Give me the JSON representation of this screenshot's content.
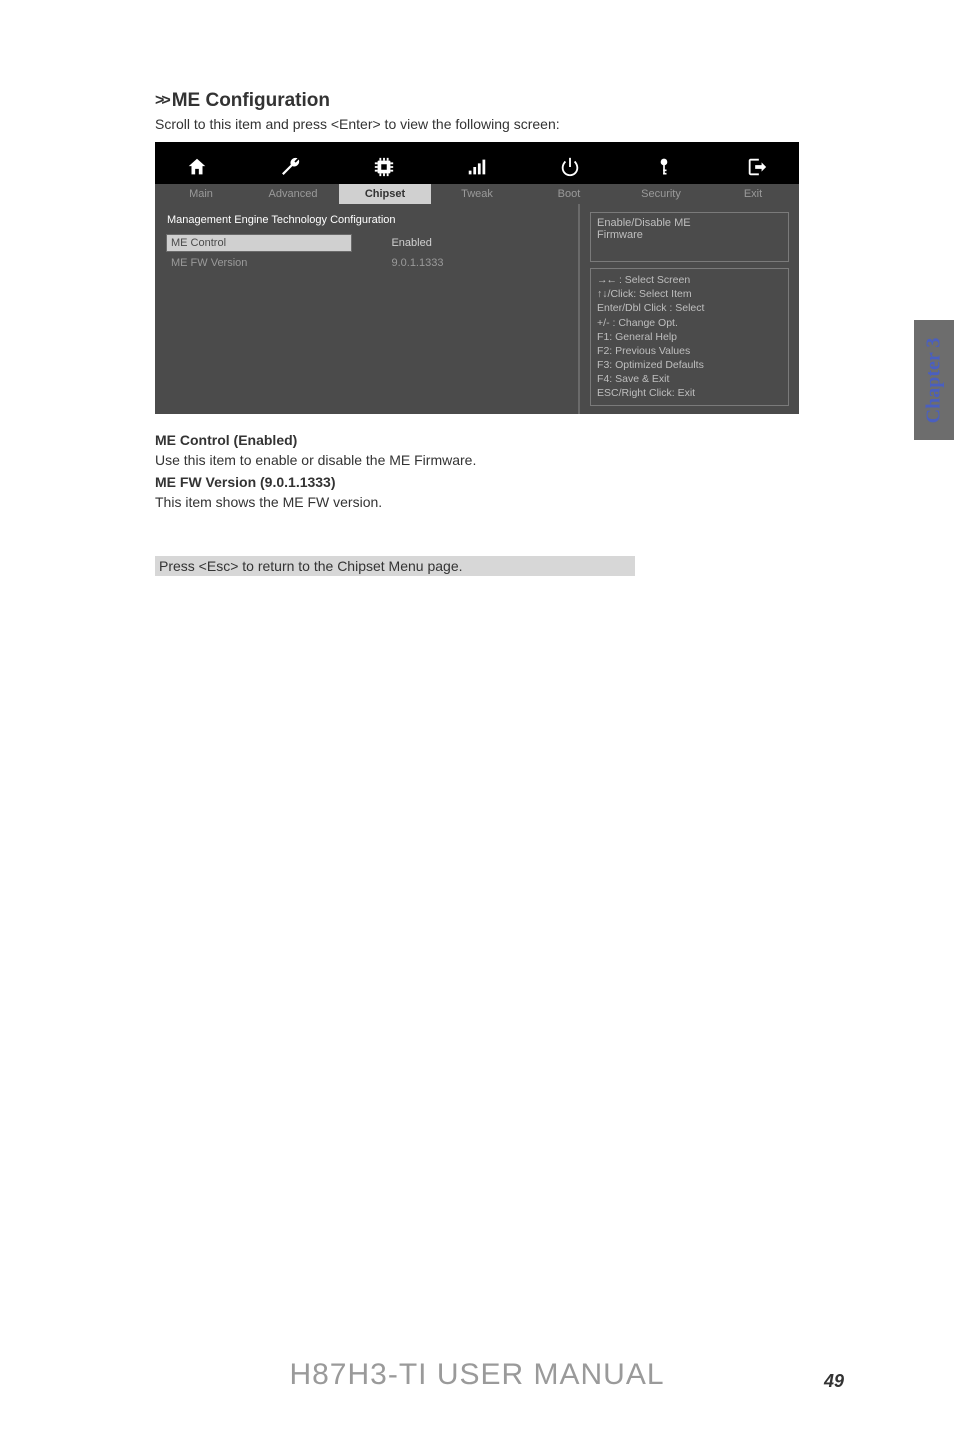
{
  "section": {
    "chev": ">>",
    "title": "ME Configuration",
    "subtitle": "Scroll to this item and press <Enter> to view the following screen:"
  },
  "bios": {
    "tabs": [
      "Main",
      "Advanced",
      "Chipset",
      "Tweak",
      "Boot",
      "Security",
      "Exit"
    ],
    "active_tab_index": 2,
    "left": {
      "header": "Management Engine Technology Configuration",
      "rows": [
        {
          "label": "ME Control",
          "value": "Enabled",
          "selected": true
        },
        {
          "label": "ME FW Version",
          "value": "9.0.1.1333",
          "selected": false
        }
      ]
    },
    "help": {
      "line1": "Enable/Disable ME",
      "line2": "Firmware"
    },
    "keys": {
      "l1_arrows": "→←",
      "l1": ": Select Screen",
      "l2": "↑↓/Click: Select Item",
      "l3": "Enter/Dbl Click : Select",
      "l4": "+/- : Change Opt.",
      "l5": "F1: General Help",
      "l6": "F2: Previous Values",
      "l7": "F3: Optimized Defaults",
      "l8": "F4: Save & Exit",
      "l9": "ESC/Right Click: Exit"
    }
  },
  "body": {
    "h1": "ME Control (Enabled)",
    "p1": "Use this item to enable or disable the ME Firmware.",
    "h2": "ME FW Version (9.0.1.1333)",
    "p2": "This item shows the ME FW version.",
    "esc": "Press <Esc> to return to the Chipset Menu page."
  },
  "chapter_tab": "Chapter 3",
  "footer": {
    "title": "H87H3-TI USER MANUAL",
    "page": "49"
  }
}
